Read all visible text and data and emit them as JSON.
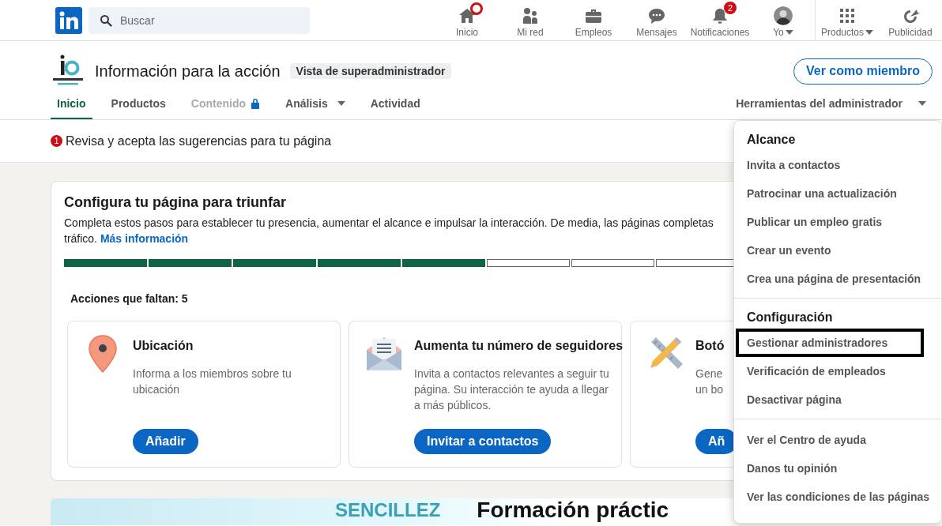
{
  "top_nav": {
    "search": {
      "placeholder": "Buscar"
    },
    "items": [
      {
        "label": "Inicio",
        "badge_dot": true,
        "dropdown": false
      },
      {
        "label": "Mi red",
        "badge_dot": false,
        "dropdown": false
      },
      {
        "label": "Empleos",
        "badge_dot": false,
        "dropdown": false
      },
      {
        "label": "Mensajes",
        "badge_dot": false,
        "dropdown": false
      },
      {
        "label": "Notificaciones",
        "badge_dot": false,
        "badge": "2",
        "dropdown": false
      },
      {
        "label": "Yo",
        "badge_dot": false,
        "dropdown": true
      }
    ],
    "extra_items": [
      {
        "label": "Productos",
        "dropdown": true
      },
      {
        "label": "Publicidad",
        "dropdown": false
      }
    ]
  },
  "page_header": {
    "name": "Información para la acción",
    "badge": "Vista de superadministrador",
    "view_button": "Ver como miembro",
    "tabs": [
      {
        "label": "Inicio",
        "selected": true,
        "locked": false,
        "dropdown": false
      },
      {
        "label": "Productos",
        "selected": false,
        "locked": false,
        "dropdown": false
      },
      {
        "label": "Contenido",
        "selected": false,
        "locked": true,
        "dropdown": false
      },
      {
        "label": "Análisis",
        "selected": false,
        "locked": false,
        "dropdown": true
      },
      {
        "label": "Actividad",
        "selected": false,
        "locked": false,
        "dropdown": false
      }
    ],
    "admin_tools": "Herramientas del administrador"
  },
  "alert": {
    "count": "1",
    "text": "Revisa y acepta las sugerencias para tu página"
  },
  "setup_card": {
    "title": "Configura tu página para triunfar",
    "description_line1": "Completa estos pasos para establecer tu presencia, aumentar el alcance e impulsar la interacción. De media, las páginas completas",
    "description_line2": "tráfico.",
    "link": "Más información",
    "progress": [
      {
        "done": true
      },
      {
        "done": true
      },
      {
        "done": true
      },
      {
        "done": true
      },
      {
        "done": true
      },
      {
        "done": false
      },
      {
        "done": false
      },
      {
        "done": false
      }
    ],
    "remaining": "Acciones que faltan: 5",
    "actions": [
      {
        "title": "Ubicación",
        "lines": [
          "Informa a los miembros sobre tu",
          "ubicación"
        ],
        "button": "Añadir"
      },
      {
        "title": "Aumenta tu número de seguidores",
        "lines": [
          "Invita a contactos relevantes a seguir tu",
          "página. Su interacción te ayuda a llegar",
          "a más públicos."
        ],
        "button": "Invitar a contactos"
      },
      {
        "title": "Botó",
        "lines": [
          "Gene",
          "un bo"
        ],
        "button": "Añ"
      }
    ]
  },
  "banner": {
    "word": "SENCILLEZ",
    "headline": "Formación práctic"
  },
  "admin_menu": {
    "sections": [
      {
        "heading": "Alcance",
        "items": [
          {
            "label": "Invita a contactos",
            "outlined": false
          },
          {
            "label": "Patrocinar una actualización",
            "outlined": false
          },
          {
            "label": "Publicar un empleo gratis",
            "outlined": false
          },
          {
            "label": "Crear un evento",
            "outlined": false
          },
          {
            "label": "Crea una página de presentación",
            "outlined": false
          }
        ]
      },
      {
        "heading": "Configuración",
        "items": [
          {
            "label": "Gestionar administradores",
            "outlined": true
          },
          {
            "label": "Verificación de empleados",
            "outlined": false
          },
          {
            "label": "Desactivar página",
            "outlined": false
          }
        ]
      },
      {
        "items": [
          {
            "label": "Ver el Centro de ayuda",
            "outlined": false
          },
          {
            "label": "Danos tu opinión",
            "outlined": false
          },
          {
            "label": "Ver las condiciones de las páginas",
            "outlined": false
          }
        ]
      }
    ]
  }
}
